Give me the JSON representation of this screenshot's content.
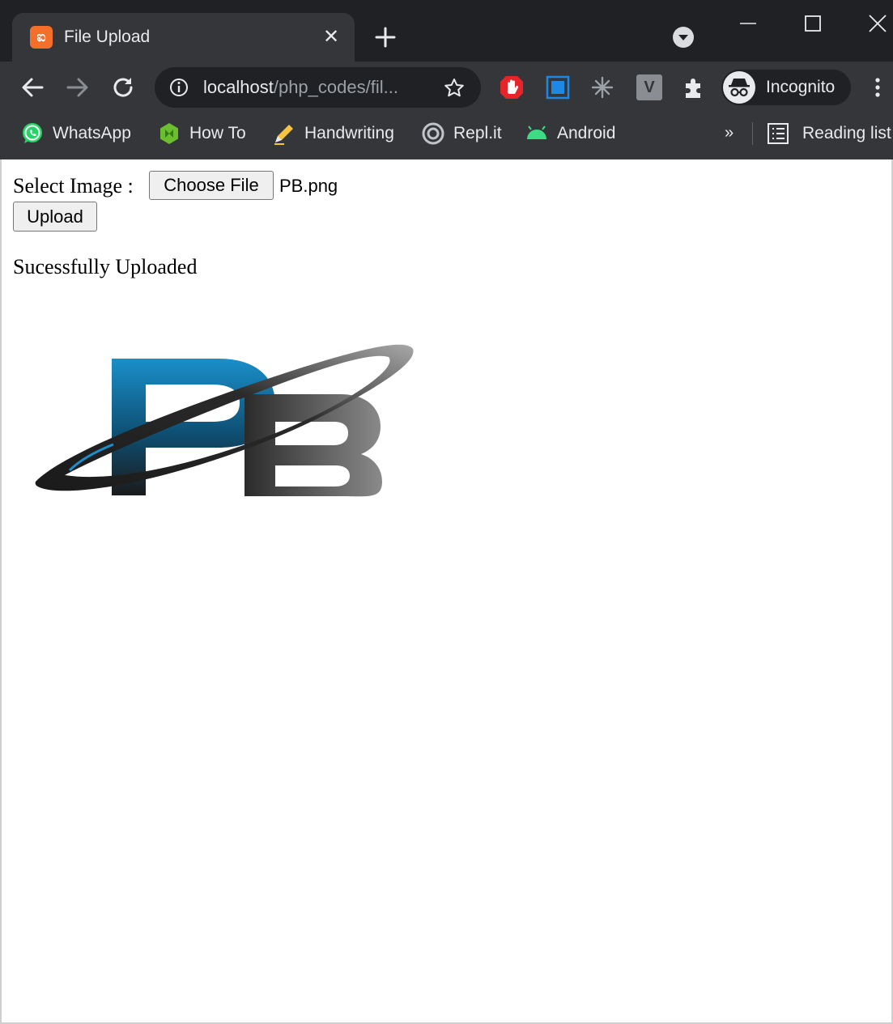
{
  "window": {
    "tab": {
      "title": "File Upload",
      "favicon": "xampp-icon",
      "favicon_glyph": "ಐ",
      "close_glyph": "✕"
    }
  },
  "toolbar": {
    "url_host": "localhost",
    "url_path": "/php_codes/fil...",
    "profile_label": "Incognito"
  },
  "bookmarks": {
    "items": [
      {
        "label": "WhatsApp",
        "icon": "whatsapp-icon"
      },
      {
        "label": "How To",
        "icon": "hexagon-icon"
      },
      {
        "label": "Handwriting",
        "icon": "pen-icon"
      },
      {
        "label": "Repl.it",
        "icon": "replit-icon"
      },
      {
        "label": "Android",
        "icon": "android-icon"
      }
    ],
    "more_glyph": "»",
    "reading_list_label": "Reading list"
  },
  "page": {
    "select_label": "Select Image :",
    "choose_file_label": "Choose File",
    "selected_file": "PB.png",
    "upload_label": "Upload",
    "status_message": "Sucessfully Uploaded",
    "logo_alt": "PB"
  },
  "colors": {
    "chrome_dark": "#202124",
    "chrome_toolbar": "#35363a",
    "logo_blue": "#1a8fc9",
    "logo_gray": "#555555"
  }
}
